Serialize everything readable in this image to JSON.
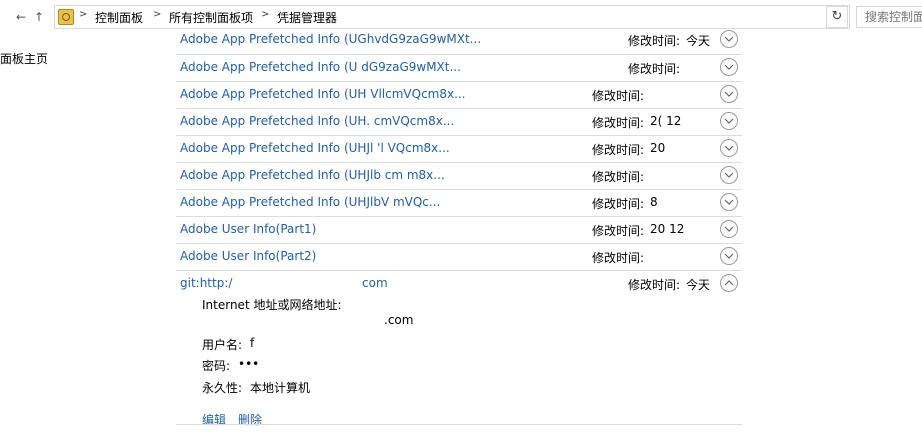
{
  "toolbar": {
    "back_arrow": "←",
    "up_arrow": "↑",
    "refresh_glyph": "↻"
  },
  "breadcrumb": {
    "items": [
      "控制面板",
      "所有控制面板项",
      "凭据管理器"
    ]
  },
  "search": {
    "placeholder": "搜索控制面板"
  },
  "sidebar": {
    "home_link": "面板主页"
  },
  "credentials": [
    {
      "name": "Adobe App Prefetched Info (UGhvdG9zaG9wMXt...",
      "mod_label": "修改时间:",
      "mod_value": "今天"
    },
    {
      "name": "Adobe App Prefetched Info (U     dG9zaG9wMXt...",
      "mod_label": "修改时间:",
      "mod_value": ""
    },
    {
      "name": "Adobe App Prefetched Info (UH     VllcmVQcm8x...",
      "mod_label": "修改时间:",
      "mod_value": ""
    },
    {
      "name": "Adobe App Prefetched Info (UH.    cmVQcm8x...",
      "mod_label": "修改时间:",
      "mod_value": "2(       12"
    },
    {
      "name": "Adobe App Prefetched Info (UHJl    'l    VQcm8x...",
      "mod_label": "修改时间:",
      "mod_value": "20        "
    },
    {
      "name": "Adobe App Prefetched Info (UHJlb    cm     m8x...",
      "mod_label": "修改时间:",
      "mod_value": ""
    },
    {
      "name": "Adobe App Prefetched Info (UHJlbV    mVQc...",
      "mod_label": "修改时间:",
      "mod_value": "      8"
    },
    {
      "name": "Adobe User Info(Part1)",
      "mod_label": "修改时间:",
      "mod_value": "20        12"
    },
    {
      "name": "Adobe User Info(Part2)",
      "mod_label": "修改时间:",
      "mod_value": ""
    }
  ],
  "expanded": {
    "name_prefix": "git:http:/",
    "name_suffix": "com",
    "mod_label": "修改时间:",
    "mod_value": "今天",
    "address_label": "Internet 地址或网络地址:",
    "address_value": ".com",
    "username_label": "用户名:",
    "username_value": "f",
    "password_label": "密码:",
    "password_value": "•••",
    "persistence_label": "永久性:",
    "persistence_value": "本地计算机",
    "edit_link": "编辑",
    "delete_link": "删除"
  }
}
